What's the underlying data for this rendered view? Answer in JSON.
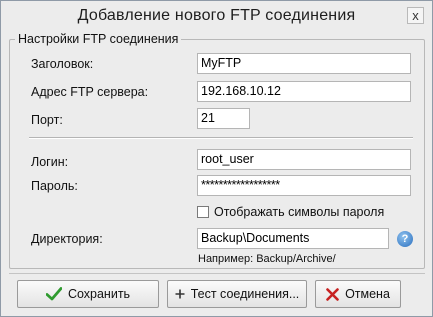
{
  "window": {
    "title": "Добавление нового FTP соединения",
    "close_glyph": "x"
  },
  "group": {
    "legend": "Настройки FTP соединения"
  },
  "fields": {
    "title_label": "Заголовок:",
    "title_value": "MyFTP",
    "server_label": "Адрес FTP сервера:",
    "server_value": "192.168.10.12",
    "port_label": "Порт:",
    "port_value": "21",
    "login_label": "Логин:",
    "login_value": "root_user",
    "password_label": "Пароль:",
    "password_value": "******************",
    "show_password_label": "Отображать символы пароля",
    "show_password_checked": false,
    "directory_label": "Директория:",
    "directory_value": "Backup\\Documents",
    "directory_hint": "Например: Backup/Archive/"
  },
  "buttons": {
    "save_label": "Сохранить",
    "test_label": "Тест соединения...",
    "cancel_label": "Отмена"
  },
  "icons": {
    "save": "checkmark-icon",
    "test": "plus-icon",
    "cancel": "cross-icon",
    "help": "help-icon"
  },
  "colors": {
    "save_icon": "#2f9b2f",
    "cancel_icon": "#c72222",
    "help_icon": "#2a6fbf"
  }
}
